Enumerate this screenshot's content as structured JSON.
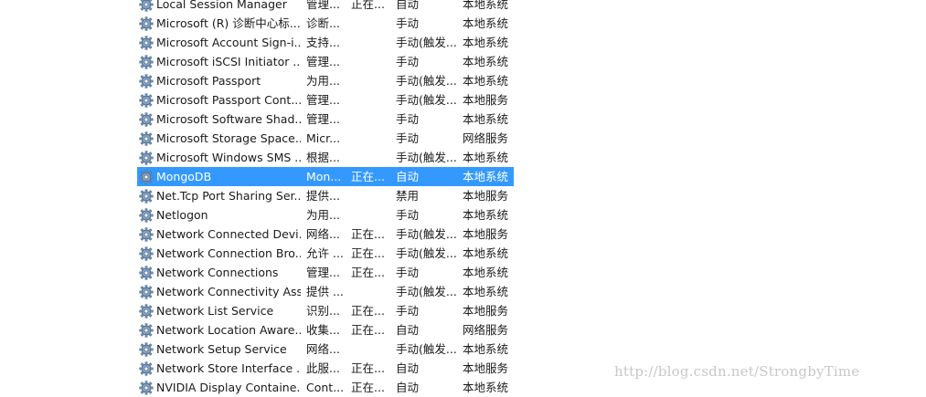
{
  "services": [
    {
      "name": "Local Session Manager",
      "description": "管理...",
      "status": "正在...",
      "startup": "自动",
      "logon": "本地系统",
      "icon": "gear-icon"
    },
    {
      "name": "Microsoft (R) 诊断中心标...",
      "description": "诊断...",
      "status": "",
      "startup": "手动",
      "logon": "本地系统",
      "icon": "gear-icon"
    },
    {
      "name": "Microsoft Account Sign-i...",
      "description": "支持...",
      "status": "",
      "startup": "手动(触发...",
      "logon": "本地系统",
      "icon": "gear-icon"
    },
    {
      "name": "Microsoft iSCSI Initiator ...",
      "description": "管理...",
      "status": "",
      "startup": "手动",
      "logon": "本地系统",
      "icon": "gear-icon"
    },
    {
      "name": "Microsoft Passport",
      "description": "为用...",
      "status": "",
      "startup": "手动(触发...",
      "logon": "本地系统",
      "icon": "gear-icon"
    },
    {
      "name": "Microsoft Passport Cont...",
      "description": "管理...",
      "status": "",
      "startup": "手动(触发...",
      "logon": "本地服务",
      "icon": "gear-icon"
    },
    {
      "name": "Microsoft Software Shad...",
      "description": "管理...",
      "status": "",
      "startup": "手动",
      "logon": "本地系统",
      "icon": "gear-icon"
    },
    {
      "name": "Microsoft Storage Space...",
      "description": "Micr...",
      "status": "",
      "startup": "手动",
      "logon": "网络服务",
      "icon": "gear-icon"
    },
    {
      "name": "Microsoft Windows SMS ...",
      "description": "根据...",
      "status": "",
      "startup": "手动(触发...",
      "logon": "本地系统",
      "icon": "gear-icon"
    },
    {
      "name": "MongoDB",
      "description": "Mon...",
      "status": "正在...",
      "startup": "自动",
      "logon": "本地系统",
      "icon": "gear-icon",
      "selected": true
    },
    {
      "name": "Net.Tcp Port Sharing Ser...",
      "description": "提供...",
      "status": "",
      "startup": "禁用",
      "logon": "本地服务",
      "icon": "gear-icon"
    },
    {
      "name": "Netlogon",
      "description": "为用...",
      "status": "",
      "startup": "手动",
      "logon": "本地系统",
      "icon": "gear-icon"
    },
    {
      "name": "Network Connected Devi...",
      "description": "网络...",
      "status": "正在...",
      "startup": "手动(触发...",
      "logon": "本地服务",
      "icon": "gear-icon"
    },
    {
      "name": "Network Connection Bro...",
      "description": "允许 ...",
      "status": "正在...",
      "startup": "手动(触发...",
      "logon": "本地系统",
      "icon": "gear-icon"
    },
    {
      "name": "Network Connections",
      "description": "管理...",
      "status": "正在...",
      "startup": "手动",
      "logon": "本地系统",
      "icon": "gear-icon"
    },
    {
      "name": "Network Connectivity Ass...",
      "description": "提供 ...",
      "status": "",
      "startup": "手动(触发...",
      "logon": "本地系统",
      "icon": "gear-icon"
    },
    {
      "name": "Network List Service",
      "description": "识别...",
      "status": "正在...",
      "startup": "手动",
      "logon": "本地服务",
      "icon": "gear-icon"
    },
    {
      "name": "Network Location Aware...",
      "description": "收集...",
      "status": "正在...",
      "startup": "自动",
      "logon": "网络服务",
      "icon": "gear-icon"
    },
    {
      "name": "Network Setup Service",
      "description": "网络...",
      "status": "",
      "startup": "手动(触发...",
      "logon": "本地系统",
      "icon": "gear-icon"
    },
    {
      "name": "Network Store Interface ...",
      "description": "此服...",
      "status": "正在...",
      "startup": "自动",
      "logon": "本地服务",
      "icon": "gear-icon"
    },
    {
      "name": "NVIDIA Display Containe...",
      "description": "Cont...",
      "status": "正在...",
      "startup": "自动",
      "logon": "本地系统",
      "icon": "gear-icon"
    }
  ],
  "watermark": "http://blog.csdn.net/StrongbyTime",
  "colors": {
    "selection": "#3399ff",
    "selected_text": "#ffffff",
    "gear_body": "#8aa4bf",
    "watermark": "#c8c8c8"
  }
}
